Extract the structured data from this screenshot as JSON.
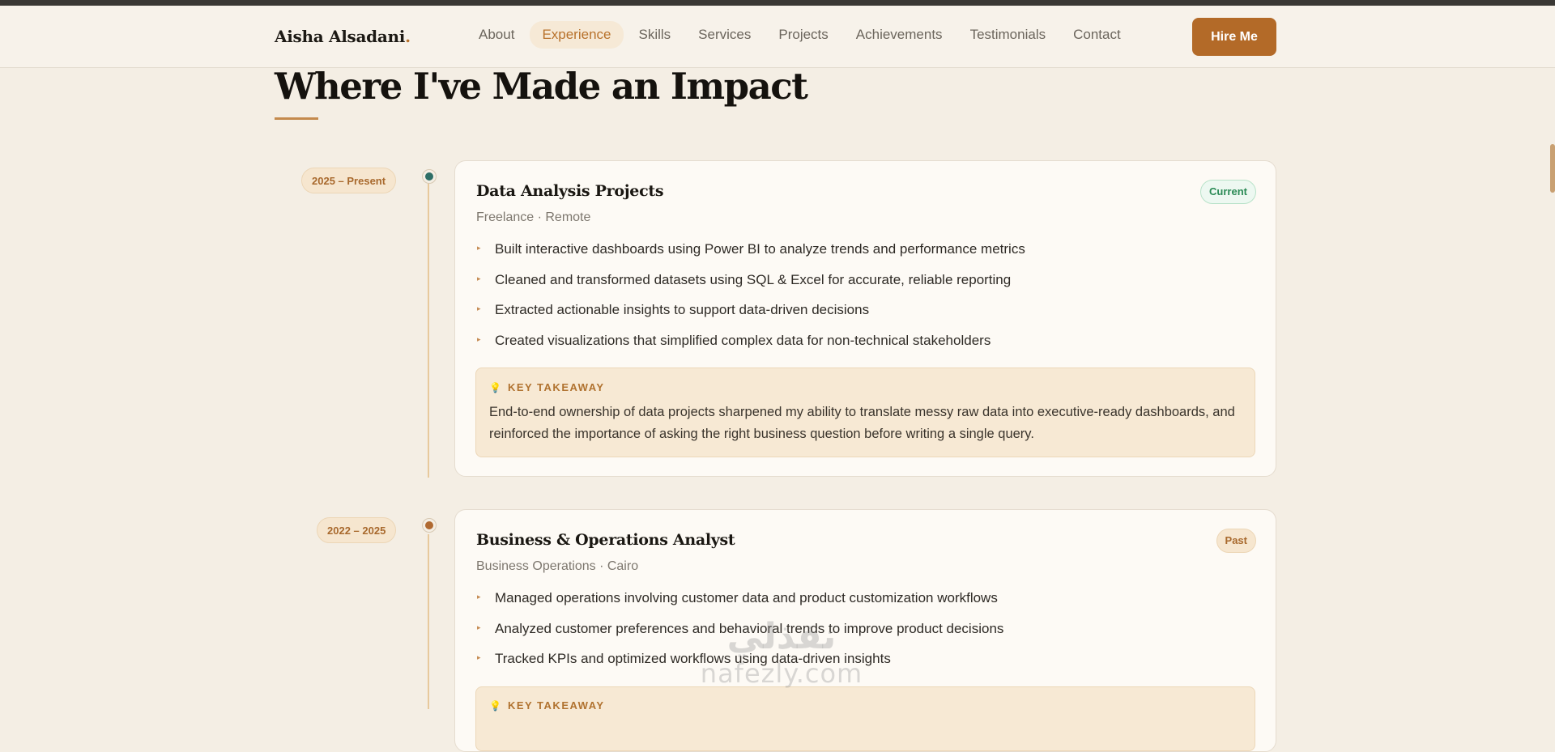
{
  "brand": {
    "name": "Aisha Alsadani",
    "dot": "."
  },
  "nav": {
    "links": [
      "About",
      "Experience",
      "Skills",
      "Services",
      "Projects",
      "Achievements",
      "Testimonials",
      "Contact"
    ],
    "active": "Experience",
    "cta": "Hire Me"
  },
  "section": {
    "title": "Where I've Made an Impact"
  },
  "experience": [
    {
      "date": "2025 – Present",
      "title": "Data Analysis Projects",
      "subtitle": "Freelance · Remote",
      "status": "Current",
      "bullets": [
        "Built interactive dashboards using Power BI to analyze trends and performance metrics",
        "Cleaned and transformed datasets using SQL & Excel for accurate, reliable reporting",
        "Extracted actionable insights to support data-driven decisions",
        "Created visualizations that simplified complex data for non-technical stakeholders"
      ],
      "takeaway_label": "KEY TAKEAWAY",
      "takeaway": "End-to-end ownership of data projects sharpened my ability to translate messy raw data into executive-ready dashboards, and reinforced the importance of asking the right business question before writing a single query."
    },
    {
      "date": "2022 – 2025",
      "title": "Business & Operations Analyst",
      "subtitle": "Business Operations · Cairo",
      "status": "Past",
      "bullets": [
        "Managed operations involving customer data and product customization workflows",
        "Analyzed customer preferences and behavioral trends to improve product decisions",
        "Tracked KPIs and optimized workflows using data-driven insights"
      ],
      "takeaway_label": "KEY TAKEAWAY"
    }
  ],
  "watermark": {
    "arabic": "نفذلي",
    "latin": "nafezly.com"
  },
  "colors": {
    "accent": "#b36a28",
    "background": "#f4eee4",
    "current_dot": "#2e6e66",
    "past_dot": "#b06a32",
    "current_badge": "#2a8a55"
  }
}
